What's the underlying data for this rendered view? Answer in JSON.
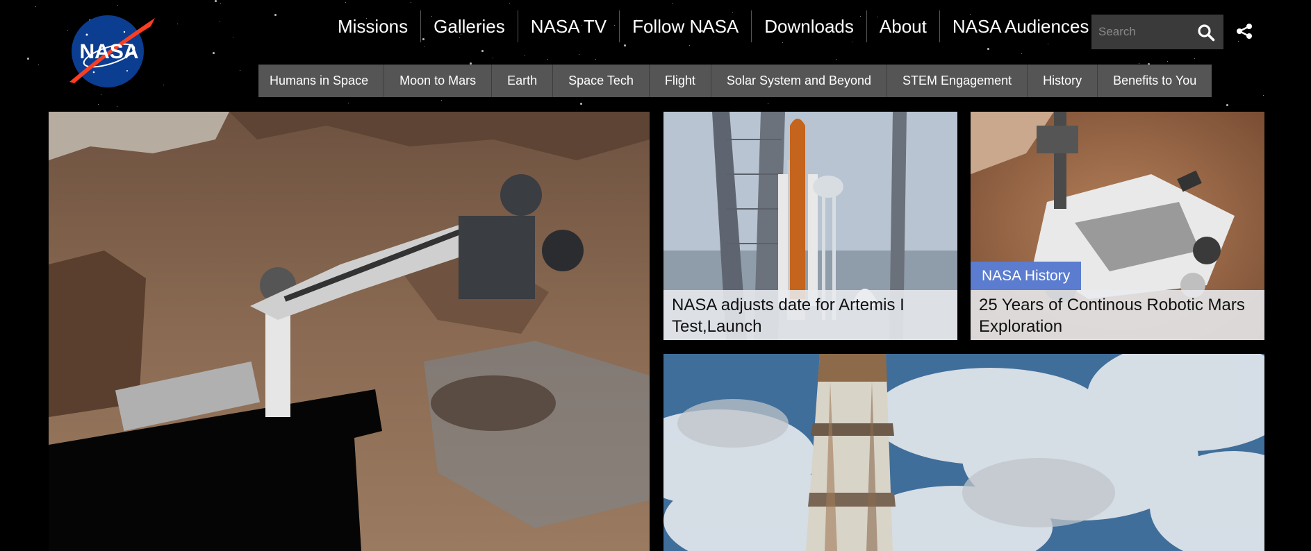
{
  "logo": {
    "text": "NASA",
    "icon": "nasa-meatball-logo"
  },
  "top_nav": [
    "Missions",
    "Galleries",
    "NASA TV",
    "Follow NASA",
    "Downloads",
    "About",
    "NASA Audiences"
  ],
  "search": {
    "placeholder": "Search",
    "icon": "search-icon"
  },
  "share": {
    "icon": "share-icon"
  },
  "sub_nav": [
    "Humans in Space",
    "Moon to Mars",
    "Earth",
    "Space Tech",
    "Flight",
    "Solar System and Beyond",
    "STEM Engagement",
    "History",
    "Benefits to You"
  ],
  "tiles": {
    "mars_rover_arm": {
      "image": "rover-robotic-arm-on-mars"
    },
    "artemis": {
      "image": "artemis-rocket-on-launch-pad",
      "caption": "NASA adjusts date for Artemis I Test,Launch"
    },
    "mars_history": {
      "image": "mars-rover-selfie",
      "tag": "NASA History",
      "caption": "25 Years of Continous Robotic Mars Exploration"
    },
    "tower": {
      "image": "weathered-tower-against-clouds"
    }
  },
  "colors": {
    "background": "#000000",
    "subnav": "#555555",
    "tag": "#5b7ccf",
    "caption_bg": "#e8eaee"
  }
}
